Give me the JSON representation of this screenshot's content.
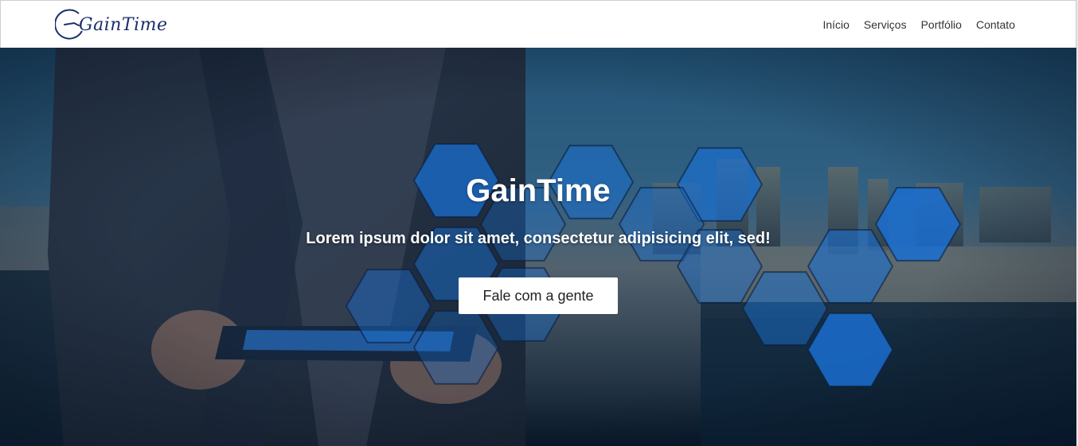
{
  "brand": {
    "name": "GainTime"
  },
  "nav": {
    "items": [
      {
        "label": "Início"
      },
      {
        "label": "Serviços"
      },
      {
        "label": "Portfólio"
      },
      {
        "label": "Contato"
      }
    ]
  },
  "hero": {
    "title": "GainTime",
    "subtitle": "Lorem ipsum dolor sit amet, consectetur adipisicing elit, sed!",
    "cta_label": "Fale com a gente"
  },
  "colors": {
    "brand_navy": "#1b2f6b",
    "hex_blue": "#1a6fd0",
    "hero_dark": "#0c2238",
    "white": "#ffffff"
  },
  "icons": [
    "clock-icon"
  ]
}
